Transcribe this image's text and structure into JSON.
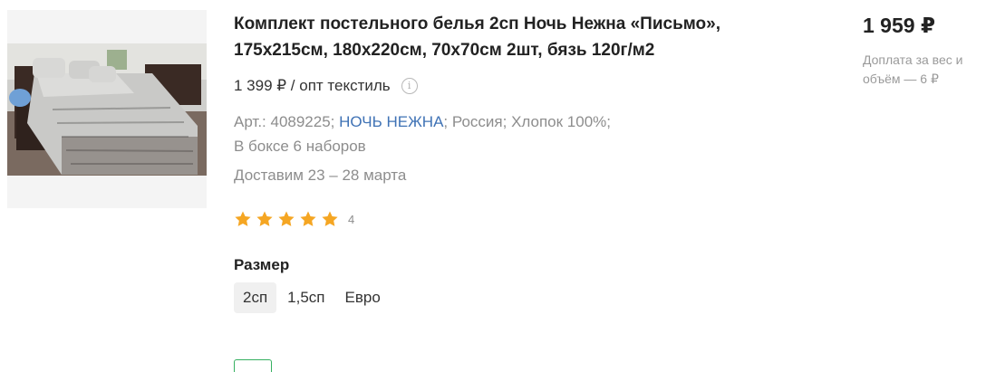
{
  "product": {
    "title": "Комплект постельного белья 2сп Ночь Нежна «Письмо», 175х215см, 180х220см, 70х70см 2шт, бязь 120г/м2",
    "opt_price": "1 399 ₽ / опт текстиль",
    "article": "Арт.: 4089225;",
    "brand": "НОЧЬ НЕЖНА",
    "country": "; Россия;",
    "material": "Хлопок 100%;",
    "box_info": "В боксе 6 наборов",
    "delivery": "Доставим 23 – 28 марта",
    "rating_value": 5,
    "rating_count": "4",
    "price": "1 959 ₽",
    "surcharge": "Доплата за вес и объём — 6 ₽",
    "info_icon": "info-icon",
    "info_symbol": "i"
  },
  "size": {
    "label": "Размер",
    "options": [
      "2сп",
      "1,5сп",
      "Евро"
    ],
    "selected": "2сп"
  },
  "colors": {
    "star": "#f5a623",
    "brand_link": "#3f72b5",
    "cart_border": "#35b060"
  }
}
